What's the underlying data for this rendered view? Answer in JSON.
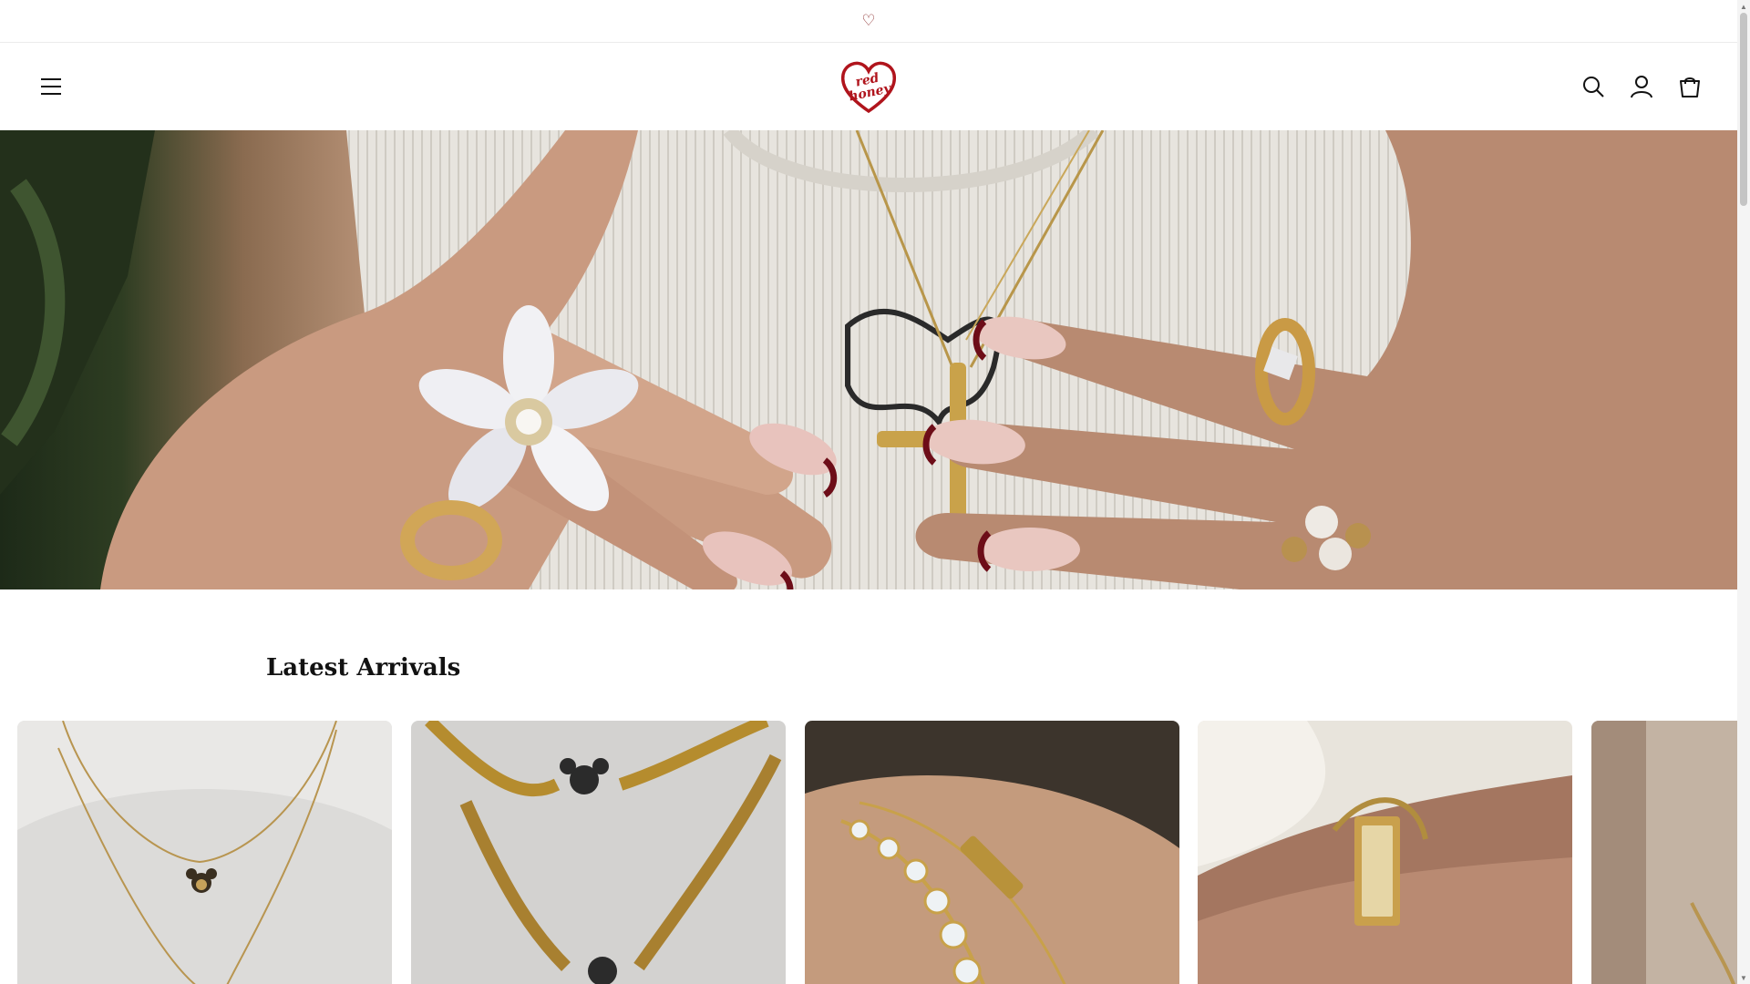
{
  "announcement": {
    "text": "♡"
  },
  "header": {
    "menu_icon": "hamburger-icon",
    "logo_lines": [
      "red",
      "honey"
    ],
    "actions": [
      {
        "name": "search-button",
        "icon": "search-icon"
      },
      {
        "name": "account-button",
        "icon": "account-icon"
      },
      {
        "name": "cart-button",
        "icon": "cart-icon"
      }
    ]
  },
  "hero": {
    "image": "hands-with-rings-and-cross-necklace"
  },
  "section": {
    "title": "Latest Arrivals"
  },
  "products": [
    {
      "image": "gold-mickey-pendant-necklaces"
    },
    {
      "image": "gold-herringbone-mickey-chains"
    },
    {
      "image": "mama-tennis-bracelet"
    },
    {
      "image": "gold-rectangular-watch"
    },
    {
      "image": "partial-product-card"
    }
  ],
  "colors": {
    "brand": "#b0141c",
    "text": "#121212",
    "border": "#ececec"
  }
}
